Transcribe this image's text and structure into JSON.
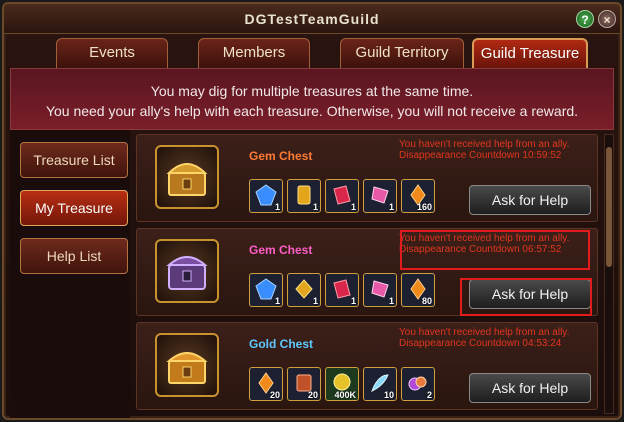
{
  "title": "DGTestTeamGuild",
  "buttons": {
    "help": "?",
    "close": "×"
  },
  "tabs": [
    {
      "label": "Events"
    },
    {
      "label": "Members"
    },
    {
      "label": "Guild Territory"
    },
    {
      "label": "Guild Treasure",
      "active": true
    }
  ],
  "notice": {
    "line1": "You may dig for multiple treasures at the same time.",
    "line2": "You need your ally's help with each treasure. Otherwise, you will not receive a reward."
  },
  "sidebar": [
    {
      "label": "Treasure List"
    },
    {
      "label": "My Treasure",
      "active": true
    },
    {
      "label": "Help List"
    }
  ],
  "cards": [
    {
      "name": "Gem Chest",
      "name_color": "#ff7a33",
      "status_line1": "You haven't received help from an ally.",
      "status_line2": "Disappearance Countdown 10:59:52",
      "items": [
        {
          "icon": "blue-gem-icon",
          "qty": "1"
        },
        {
          "icon": "gold-gem-icon",
          "qty": "1"
        },
        {
          "icon": "red-crystal-icon",
          "qty": "1"
        },
        {
          "icon": "pink-crystal-icon",
          "qty": "1"
        },
        {
          "icon": "amber-shard-icon",
          "qty": "160"
        }
      ],
      "button": "Ask for Help"
    },
    {
      "name": "Gem Chest",
      "name_color": "#ff5ec8",
      "status_line1": "You haven't received help from an ally.",
      "status_line2": "Disappearance Countdown 06:57:52",
      "items": [
        {
          "icon": "blue-gem-icon",
          "qty": "1"
        },
        {
          "icon": "gold-gem-icon",
          "qty": "1"
        },
        {
          "icon": "red-crystal-icon",
          "qty": "1"
        },
        {
          "icon": "pink-crystal-icon",
          "qty": "1"
        },
        {
          "icon": "amber-shard-icon",
          "qty": "80"
        }
      ],
      "button": "Ask for Help"
    },
    {
      "name": "Gold Chest",
      "name_color": "#5fc9ff",
      "status_line1": "You haven't received help from an ally.",
      "status_line2": "Disappearance Countdown 04:53:24",
      "items": [
        {
          "icon": "amber-shard-icon",
          "qty": "20"
        },
        {
          "icon": "scroll-icon",
          "qty": "20"
        },
        {
          "icon": "gold-coin-icon",
          "qty": "400K"
        },
        {
          "icon": "feather-icon",
          "qty": "10"
        },
        {
          "icon": "gem-pile-icon",
          "qty": "2"
        }
      ],
      "button": "Ask for Help"
    }
  ]
}
